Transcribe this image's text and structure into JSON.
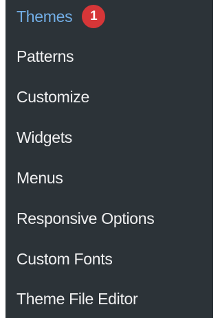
{
  "submenu": {
    "items": [
      {
        "label": "Themes",
        "current": true,
        "badge": "1"
      },
      {
        "label": "Patterns"
      },
      {
        "label": "Customize"
      },
      {
        "label": "Widgets"
      },
      {
        "label": "Menus"
      },
      {
        "label": "Responsive Options"
      },
      {
        "label": "Custom Fonts"
      },
      {
        "label": "Theme File Editor"
      }
    ]
  },
  "colors": {
    "background": "#2c3338",
    "text": "#f0f0f1",
    "current_text": "#72aee6",
    "badge": "#d63638"
  }
}
